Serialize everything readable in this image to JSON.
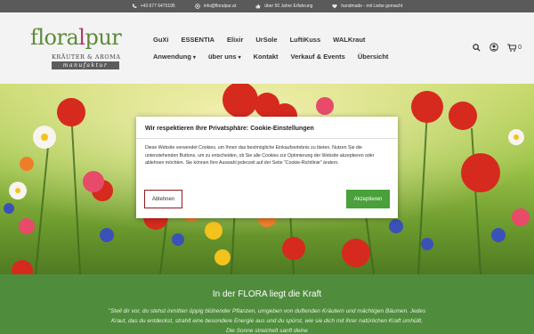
{
  "topbar": {
    "phone": "+43 677 6475195",
    "email": "info@floralpur.at",
    "experience": "über 50 Jahre Erfahrung",
    "handmade": "handmade - mit Liebe gemacht"
  },
  "logo": {
    "word_start": "flora",
    "word_mid": "l",
    "word_end": "pur",
    "sub1": "KRÄUTER & AROMA",
    "sub2": "manufaktur"
  },
  "nav": {
    "row1": [
      "GuXi",
      "ESSENTIA",
      "Elixir",
      "UrSole",
      "LuftiKuss",
      "WALKraut"
    ],
    "row2": [
      "Anwendung",
      "über uns",
      "Kontakt",
      "Verkauf & Events",
      "Übersicht"
    ],
    "cart_count": "0"
  },
  "dialog": {
    "title": "Wir respektieren Ihre Privatsphäre: Cookie-Einstellungen",
    "text": "Diese Website verwendet Cookies, um Ihnen das bestmögliche Einkaufserlebnis zu bieten. Nutzen Sie die untenstehenden Buttons, um zu entscheiden, ob Sie alle Cookies zur Optimierung der Website akzeptieren oder ablehnen möchten. Sie können Ihre Auswahl jederzeit auf der Seite \"Cookie-Richtlinie\" ändern.",
    "decline": "Ablehnen",
    "accept": "Akzeptieren"
  },
  "section": {
    "title": "In der FLORA liegt die Kraft",
    "text": "\"Stell dir vor, du stehst inmitten üppig blühender Pflanzen, umgeben von duftenden Kräutern und mächtigen Bäumen. Jedes Kraut, das du entdeckst, strahlt eine besondere Energie aus und du spürst, wie sie dich mit ihrer natürlichen Kraft umhüllt. Die Sonne streichelt sanft deine"
  },
  "colors": {
    "topbar": "#5a5a5a",
    "accent_green": "#4aa03a",
    "section_green": "#4f8d3d",
    "logo_green": "#5c8a3a",
    "logo_pink": "#b03a6a"
  }
}
